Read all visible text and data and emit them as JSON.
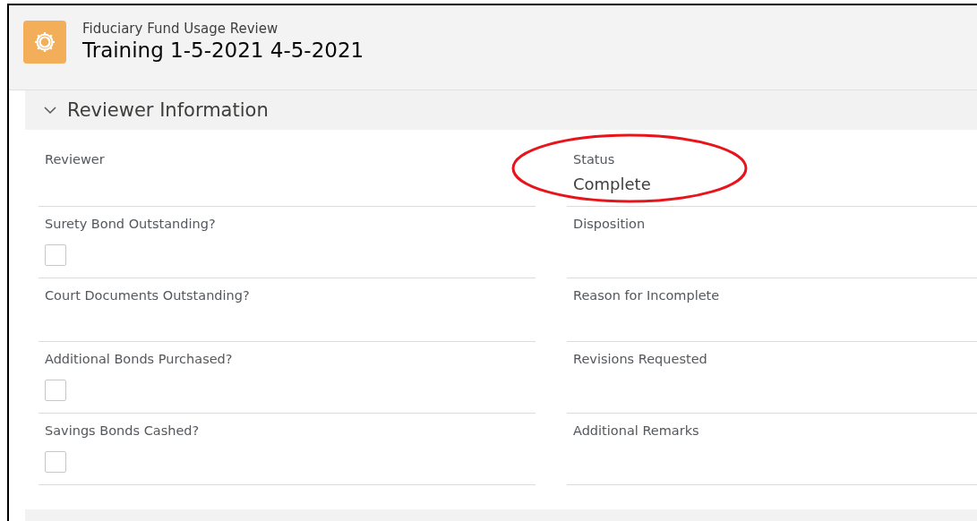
{
  "header": {
    "object_type": "Fiduciary Fund Usage Review",
    "title": "Training 1-5-2021 4-5-2021"
  },
  "section": {
    "title": "Reviewer Information",
    "expanded": true
  },
  "rows": [
    {
      "left": {
        "label": "Reviewer",
        "kind": "text",
        "circled": false
      },
      "right": {
        "label": "Status",
        "kind": "text",
        "value": "Complete",
        "circled": true
      }
    },
    {
      "left": {
        "label": "Surety Bond Outstanding?",
        "kind": "checkbox",
        "checked": false,
        "circled": false
      },
      "right": {
        "label": "Disposition",
        "kind": "text",
        "circled": false
      }
    },
    {
      "left": {
        "label": "Court Documents Outstanding?",
        "kind": "text",
        "circled": false
      },
      "right": {
        "label": "Reason for Incomplete",
        "kind": "text",
        "circled": false
      }
    },
    {
      "left": {
        "label": "Additional Bonds Purchased?",
        "kind": "checkbox",
        "checked": false,
        "circled": false
      },
      "right": {
        "label": "Revisions Requested",
        "kind": "text",
        "circled": false
      }
    },
    {
      "left": {
        "label": "Savings Bonds Cashed?",
        "kind": "checkbox",
        "checked": false,
        "circled": false
      },
      "right": {
        "label": "Additional Remarks",
        "kind": "text",
        "circled": false
      }
    }
  ]
}
